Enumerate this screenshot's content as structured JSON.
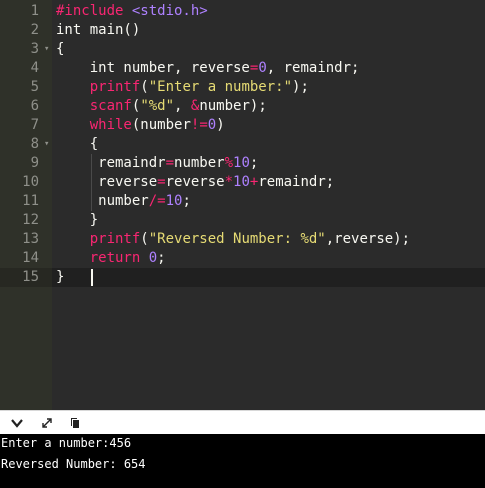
{
  "editor": {
    "lines": [
      {
        "n": "1",
        "fold": "",
        "tokens": [
          {
            "t": "#include ",
            "c": "kw"
          },
          {
            "t": "<stdio.h>",
            "c": "inc"
          }
        ]
      },
      {
        "n": "2",
        "fold": "",
        "tokens": [
          {
            "t": "int main()",
            "c": ""
          }
        ]
      },
      {
        "n": "3",
        "fold": "▾",
        "tokens": [
          {
            "t": "{",
            "c": ""
          }
        ]
      },
      {
        "n": "4",
        "fold": "",
        "tokens": [
          {
            "t": "    int number, reverse",
            "c": ""
          },
          {
            "t": "=",
            "c": "op"
          },
          {
            "t": "0",
            "c": "num"
          },
          {
            "t": ", remaindr;",
            "c": ""
          }
        ]
      },
      {
        "n": "5",
        "fold": "",
        "tokens": [
          {
            "t": "    ",
            "c": ""
          },
          {
            "t": "printf",
            "c": "kw"
          },
          {
            "t": "(",
            "c": ""
          },
          {
            "t": "\"Enter a number:\"",
            "c": "str"
          },
          {
            "t": ");",
            "c": ""
          }
        ]
      },
      {
        "n": "6",
        "fold": "",
        "tokens": [
          {
            "t": "    ",
            "c": ""
          },
          {
            "t": "scanf",
            "c": "kw"
          },
          {
            "t": "(",
            "c": ""
          },
          {
            "t": "\"%d\"",
            "c": "str"
          },
          {
            "t": ", ",
            "c": ""
          },
          {
            "t": "&",
            "c": "op"
          },
          {
            "t": "number);",
            "c": ""
          }
        ]
      },
      {
        "n": "7",
        "fold": "",
        "tokens": [
          {
            "t": "    ",
            "c": ""
          },
          {
            "t": "while",
            "c": "kw"
          },
          {
            "t": "(number",
            "c": ""
          },
          {
            "t": "!=",
            "c": "op"
          },
          {
            "t": "0",
            "c": "num"
          },
          {
            "t": ")",
            "c": ""
          }
        ]
      },
      {
        "n": "8",
        "fold": "▾",
        "tokens": [
          {
            "t": "    {",
            "c": ""
          }
        ]
      },
      {
        "n": "9",
        "fold": "",
        "tokens": [
          {
            "t": "     remaindr",
            "c": ""
          },
          {
            "t": "=",
            "c": "op"
          },
          {
            "t": "number",
            "c": ""
          },
          {
            "t": "%",
            "c": "op"
          },
          {
            "t": "10",
            "c": "num"
          },
          {
            "t": ";",
            "c": ""
          }
        ]
      },
      {
        "n": "10",
        "fold": "",
        "tokens": [
          {
            "t": "     reverse",
            "c": ""
          },
          {
            "t": "=",
            "c": "op"
          },
          {
            "t": "reverse",
            "c": ""
          },
          {
            "t": "*",
            "c": "op"
          },
          {
            "t": "10",
            "c": "num"
          },
          {
            "t": "+",
            "c": "op"
          },
          {
            "t": "remaindr;",
            "c": ""
          }
        ]
      },
      {
        "n": "11",
        "fold": "",
        "tokens": [
          {
            "t": "     number",
            "c": ""
          },
          {
            "t": "/=",
            "c": "op"
          },
          {
            "t": "10",
            "c": "num"
          },
          {
            "t": ";",
            "c": ""
          }
        ]
      },
      {
        "n": "12",
        "fold": "",
        "tokens": [
          {
            "t": "    }",
            "c": ""
          }
        ]
      },
      {
        "n": "13",
        "fold": "",
        "tokens": [
          {
            "t": "    ",
            "c": ""
          },
          {
            "t": "printf",
            "c": "kw"
          },
          {
            "t": "(",
            "c": ""
          },
          {
            "t": "\"Reversed Number: %d\"",
            "c": "str"
          },
          {
            "t": ",reverse);",
            "c": ""
          }
        ]
      },
      {
        "n": "14",
        "fold": "",
        "tokens": [
          {
            "t": "    ",
            "c": ""
          },
          {
            "t": "return",
            "c": "kw"
          },
          {
            "t": " ",
            "c": ""
          },
          {
            "t": "0",
            "c": "num"
          },
          {
            "t": ";",
            "c": ""
          }
        ]
      },
      {
        "n": "15",
        "fold": "",
        "tokens": [
          {
            "t": "}",
            "c": ""
          }
        ]
      }
    ],
    "active_line": "15"
  },
  "toolbar": {
    "buttons": [
      {
        "name": "collapse-output-icon",
        "glyph": "⌄"
      },
      {
        "name": "expand-output-icon",
        "glyph": "⤢"
      },
      {
        "name": "copy-output-icon",
        "glyph": "⧉"
      }
    ]
  },
  "console": {
    "lines": [
      "Enter a number:456",
      "Reversed Number: 654"
    ]
  }
}
